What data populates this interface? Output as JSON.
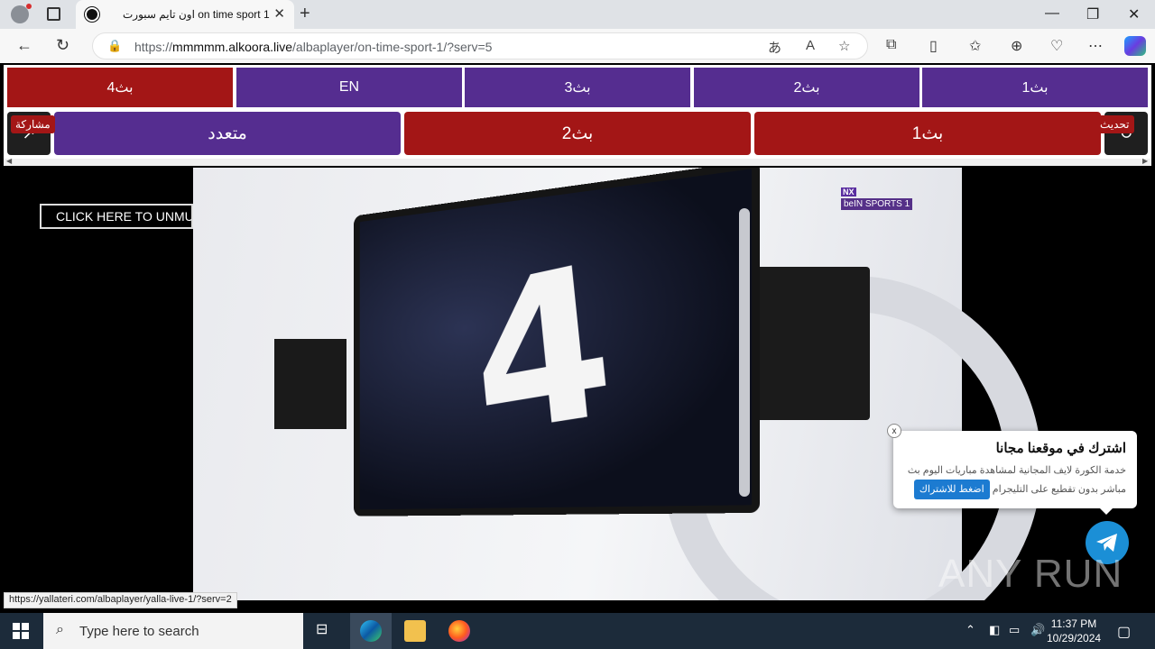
{
  "browser": {
    "tab_title": "اون تايم سبورت on time sport 1",
    "tab_close": "✕",
    "new_tab": "+",
    "url_host_prefix": "https://",
    "url_host": "mmmmm.alkoora.live",
    "url_path": "/albaplayer/on-time-sport-1/?serv=5",
    "window_controls": [
      "—",
      "❐",
      "✕"
    ]
  },
  "servers": {
    "row1": [
      {
        "label": "بث4",
        "color": "#a31616"
      },
      {
        "label": "EN",
        "color": "#552d90"
      },
      {
        "label": "بث3",
        "color": "#552d90"
      },
      {
        "label": "بث2",
        "color": "#552d90"
      },
      {
        "label": "بث1",
        "color": "#552d90"
      }
    ],
    "row2": [
      {
        "label": "متعدد",
        "color": "#552d90"
      },
      {
        "label": "بث2",
        "color": "#a31616"
      },
      {
        "label": "بث1",
        "color": "#a31616"
      }
    ],
    "share_label": "مشاركة",
    "refresh_label": "تحديث"
  },
  "video": {
    "unmute_label": "CLICK HERE TO UNMUTE",
    "channel_logo_top": "NX",
    "channel_logo": "beIN SPORTS 1",
    "screen_number": "4"
  },
  "promo": {
    "title": "اشترك في موقعنا مجانا",
    "text_line1": "خدمة الكورة لايف المجانية لمشاهدة مباريات اليوم بث",
    "text_line2": "مباشر بدون تقطيع على التليجرام",
    "button": "اضغط للاشتراك",
    "close": "x"
  },
  "watermark": "ANY RUN",
  "status_link": "https://yallateri.com/albaplayer/yalla-live-1/?serv=2",
  "taskbar": {
    "search_placeholder": "Type here to search",
    "time": "11:37 PM",
    "date": "10/29/2024"
  }
}
